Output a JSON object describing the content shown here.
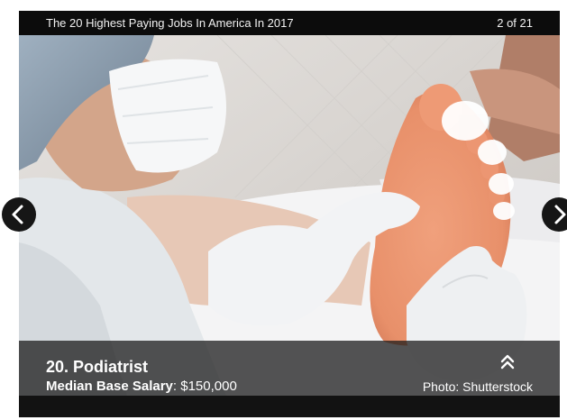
{
  "slideshow": {
    "title": "The 20 Highest Paying Jobs In America In 2017",
    "counter": "2 of 21"
  },
  "caption": {
    "heading": "20. Podiatrist",
    "salary_label": "Median Base Salary",
    "salary_value": ": $150,000",
    "photo_credit": "Photo: Shutterstock"
  },
  "icons": {
    "prev": "chevron-left-icon",
    "next": "chevron-right-icon",
    "expand": "double-chevron-up-icon"
  },
  "colors": {
    "frame": "#121212",
    "caption_overlay": "#191919",
    "text": "#ffffff"
  }
}
